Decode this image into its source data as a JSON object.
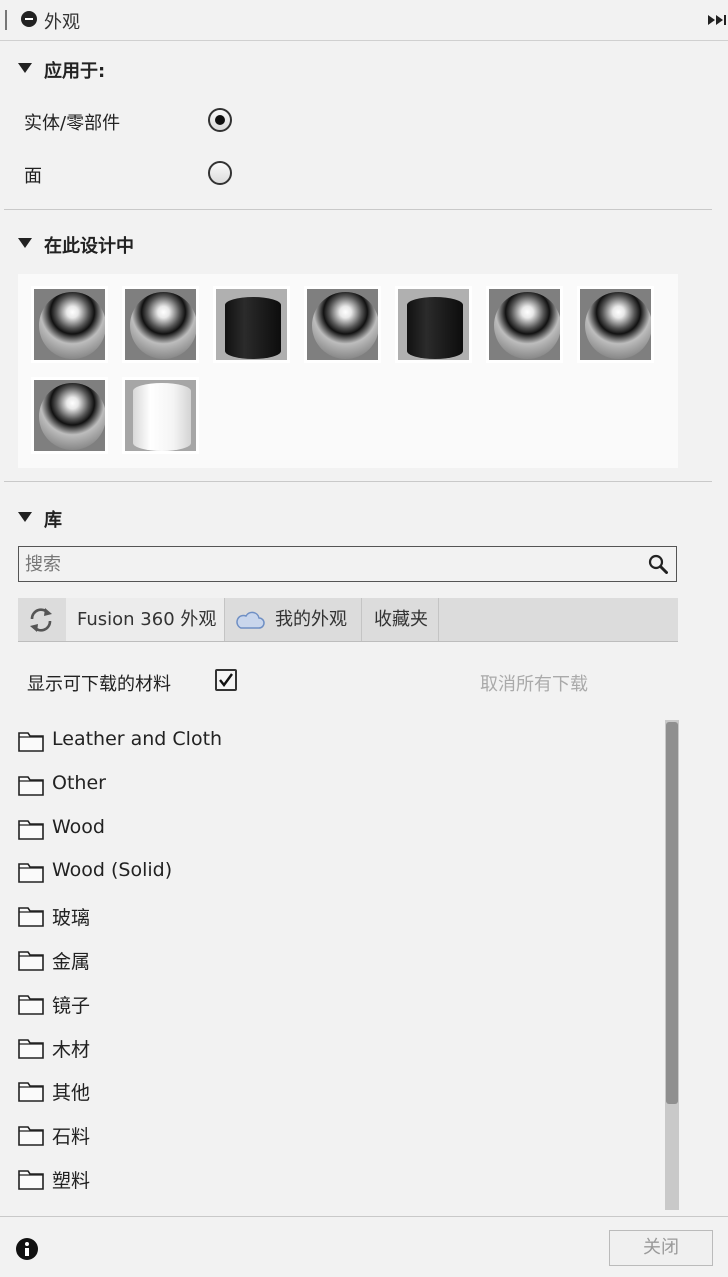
{
  "panel": {
    "title": "外观"
  },
  "apply_to": {
    "title": "应用于:",
    "options": [
      {
        "label": "实体/零部件",
        "checked": true
      },
      {
        "label": "面",
        "checked": false
      }
    ]
  },
  "in_design": {
    "title": "在此设计中",
    "swatches": [
      "metal-sphere",
      "metal-sphere",
      "black-cylinder",
      "metal-sphere",
      "black-cylinder",
      "metal-sphere",
      "metal-sphere",
      "metal-sphere",
      "white-cylinder"
    ]
  },
  "library": {
    "title": "库",
    "search_placeholder": "搜索",
    "tabs": [
      {
        "label": "Fusion 360 外观",
        "icon": "refresh-icon",
        "active": true
      },
      {
        "label": "我的外观",
        "icon": "cloud-icon",
        "active": false
      },
      {
        "label": "收藏夹",
        "active": false
      }
    ],
    "show_downloadable_label": "显示可下载的材料",
    "show_downloadable_checked": true,
    "cancel_downloads_label": "取消所有下载",
    "folders": [
      "Leather and Cloth",
      "Other",
      "Wood",
      "Wood (Solid)",
      "玻璃",
      "金属",
      "镜子",
      "木材",
      "其他",
      "石料",
      "塑料"
    ]
  },
  "footer": {
    "close_label": "关闭"
  },
  "colors": {
    "background": "#f2f2f2",
    "accent_cloud": "#6f8fc4"
  }
}
